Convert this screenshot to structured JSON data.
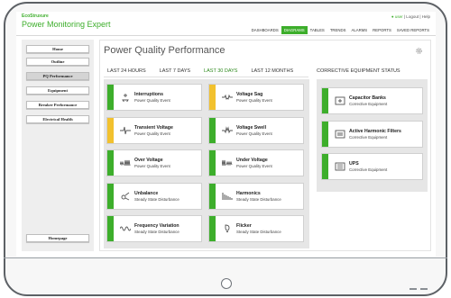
{
  "header": {
    "brand_small": "EcoStruxure",
    "brand_title": "Power Monitoring Expert",
    "user": "● user",
    "links": "| Logout | Help",
    "nav": [
      "DASHBOARDS",
      "DIAGRAMS",
      "TABLES",
      "TRENDS",
      "ALARMS",
      "REPORTS",
      "SAVED REPORTS"
    ],
    "active_nav": "DIAGRAMS"
  },
  "sidebar": {
    "items": [
      "Home",
      "Outline",
      "PQ Performance",
      "Equipment",
      "Breaker Performance",
      "Electrical Health"
    ],
    "active": "PQ Performance",
    "homepage": "Homepage"
  },
  "main": {
    "title": "Power Quality Performance",
    "tabs": [
      "LAST 24 HOURS",
      "LAST 7 DAYS",
      "LAST 30 DAYS",
      "LAST 12 MONTHS"
    ],
    "active_tab": "LAST 30 DAYS",
    "ce_title": "CORRECTIVE EQUIPMENT STATUS"
  },
  "events": [
    {
      "name": "Interruptions",
      "type": "Power Quality Event",
      "status": "green",
      "icon": "interruption-icon"
    },
    {
      "name": "Voltage Sag",
      "type": "Power Quality Event",
      "status": "yellow",
      "icon": "voltage-sag-icon"
    },
    {
      "name": "Transient Voltage",
      "type": "Power Quality Event",
      "status": "yellow",
      "icon": "transient-icon"
    },
    {
      "name": "Voltage Swell",
      "type": "Power Quality Event",
      "status": "green",
      "icon": "voltage-swell-icon"
    },
    {
      "name": "Over Voltage",
      "type": "Power Quality Event",
      "status": "green",
      "icon": "over-voltage-icon"
    },
    {
      "name": "Under Voltage",
      "type": "Power Quality Event",
      "status": "green",
      "icon": "under-voltage-icon"
    },
    {
      "name": "Unbalance",
      "type": "Steady State Disturbance",
      "status": "green",
      "icon": "unbalance-icon"
    },
    {
      "name": "Harmonics",
      "type": "Steady State Disturbance",
      "status": "green",
      "icon": "harmonics-icon"
    },
    {
      "name": "Frequency Variation",
      "type": "Steady State Disturbance",
      "status": "green",
      "icon": "frequency-icon"
    },
    {
      "name": "Flicker",
      "type": "Steady State Disturbance",
      "status": "green",
      "icon": "flicker-icon"
    }
  ],
  "equipment": [
    {
      "name": "Capacitor Banks",
      "type": "Corrective Equipment",
      "status": "green",
      "icon": "capacitor-icon"
    },
    {
      "name": "Active Harmonic Filters",
      "type": "Corrective Equipment",
      "status": "green",
      "icon": "filter-icon"
    },
    {
      "name": "UPS",
      "type": "Corrective Equipment",
      "status": "green",
      "icon": "ups-icon"
    }
  ],
  "colors": {
    "brand": "#3dae2b",
    "green": "#3dae2b",
    "yellow": "#f2c12e"
  }
}
